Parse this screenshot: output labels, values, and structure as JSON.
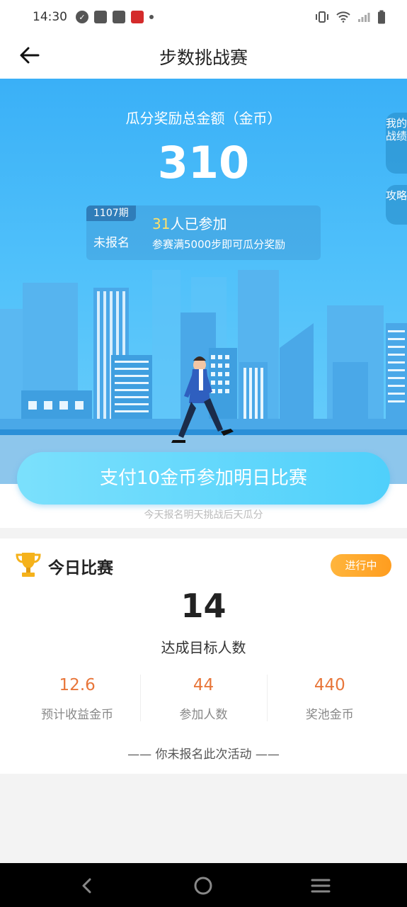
{
  "status_bar": {
    "time": "14:30",
    "icons": [
      "check-circle-icon",
      "mail-icon",
      "mail-icon",
      "app-notification-icon",
      "dot-icon",
      "vibrate-icon",
      "wifi-icon",
      "signal-icon",
      "battery-icon"
    ]
  },
  "header": {
    "title": "步数挑战赛",
    "back_icon": "arrow-left-icon"
  },
  "hero": {
    "subtitle": "瓜分奖励总金额（金币）",
    "amount": "310",
    "period": "1107期",
    "status": "未报名",
    "joined_count": "31",
    "joined_suffix": "人已参加",
    "rule": "参赛满5000步即可瓜分奖励",
    "side_tab_1": "我的战绩",
    "side_tab_2": "攻略"
  },
  "pay": {
    "button_label": "支付10金币参加明日比赛",
    "note": "今天报名明天挑战后天瓜分"
  },
  "today": {
    "title": "今日比赛",
    "status": "进行中",
    "goal_count": "14",
    "goal_label": "达成目标人数",
    "stats": [
      {
        "value": "12.6",
        "label": "预计收益金币"
      },
      {
        "value": "44",
        "label": "参加人数"
      },
      {
        "value": "440",
        "label": "奖池金币"
      }
    ],
    "footer": "—— 你未报名此次活动 ——"
  },
  "colors": {
    "hero_blue": "#3ab0f7",
    "accent_orange": "#e8763a",
    "pill_orange": "#ff9d1f",
    "highlight_yellow": "#ffe16a"
  }
}
